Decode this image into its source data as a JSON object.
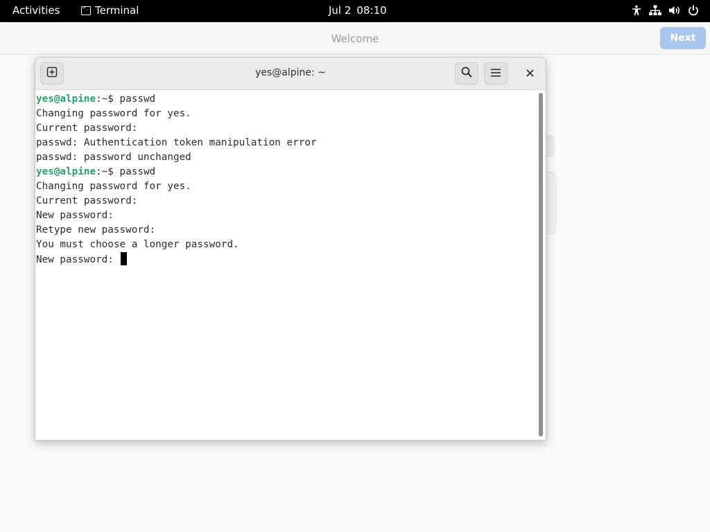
{
  "topbar": {
    "activities": "Activities",
    "app_name": "Terminal",
    "date": "Jul 2",
    "time": "08:10",
    "tray_icons": [
      "accessibility-icon",
      "network-icon",
      "volume-icon",
      "power-icon"
    ]
  },
  "welcome": {
    "title": "Welcome",
    "next_label": "Next",
    "next_color": "#a9c6ec"
  },
  "terminal": {
    "title": "yes@alpine: ~",
    "header_buttons": [
      "new-tab-icon",
      "search-icon",
      "menu-icon",
      "close-icon"
    ],
    "prompt_color": "#26a269",
    "lines": [
      {
        "user": "yes@alpine",
        "rest": ":~$ passwd"
      },
      {
        "text": "Changing password for yes."
      },
      {
        "text": "Current password:"
      },
      {
        "text": "passwd: Authentication token manipulation error"
      },
      {
        "text": "passwd: password unchanged"
      },
      {
        "user": "yes@alpine",
        "rest": ":~$ passwd"
      },
      {
        "text": "Changing password for yes."
      },
      {
        "text": "Current password:"
      },
      {
        "text": "New password:"
      },
      {
        "text": "Retype new password:"
      },
      {
        "text": "You must choose a longer password."
      },
      {
        "text": "New password: "
      }
    ]
  }
}
